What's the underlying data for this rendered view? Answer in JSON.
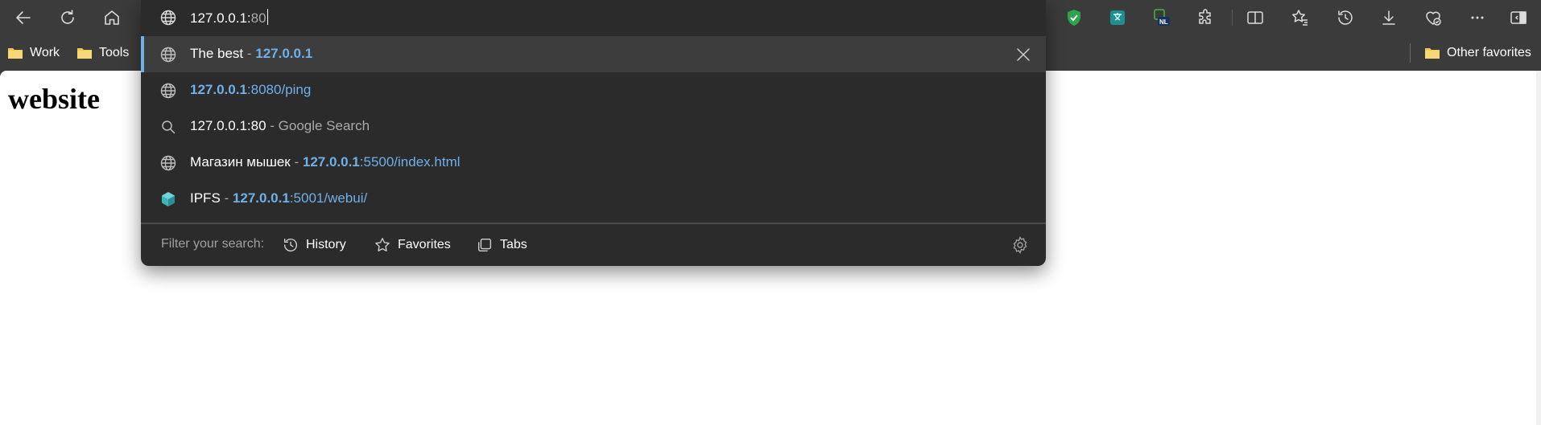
{
  "omnibox": {
    "typed_text": "127.0.0.1:",
    "autocomplete_text": "80",
    "suggestions": [
      {
        "type": "history",
        "icon": "globe-icon",
        "title": "The best",
        "separator": " - ",
        "url_bold": "127.0.0.1",
        "url_rest": "",
        "selected": true
      },
      {
        "type": "url",
        "icon": "globe-icon",
        "title": "",
        "separator": "",
        "url_bold": "127.0.0.1",
        "url_rest": ":8080/ping"
      },
      {
        "type": "search",
        "icon": "search-icon",
        "query": "127.0.0.1:80",
        "separator": " - ",
        "engine": "Google Search"
      },
      {
        "type": "history",
        "icon": "globe-icon",
        "title": "Магазин мышек",
        "separator": " - ",
        "url_bold": "127.0.0.1",
        "url_rest": ":5500/index.html"
      },
      {
        "type": "history",
        "icon": "ipfs-cube-icon",
        "title": "IPFS",
        "separator": " - ",
        "url_bold": "127.0.0.1",
        "url_rest": ":5001/webui/"
      }
    ],
    "filter": {
      "label": "Filter your search:",
      "chips": [
        "History",
        "Favorites",
        "Tabs"
      ]
    }
  },
  "bookmarks": {
    "items": [
      "Work",
      "Tools"
    ],
    "other_favorites": "Other favorites"
  },
  "page": {
    "title": "website"
  },
  "colors": {
    "chrome_bg": "#3b3b3b",
    "popup_bg": "#2b2b2b",
    "selected_bg": "#3d3d3d",
    "accent_blue": "#6fb0e8",
    "folder_yellow": "#f2c94c"
  }
}
